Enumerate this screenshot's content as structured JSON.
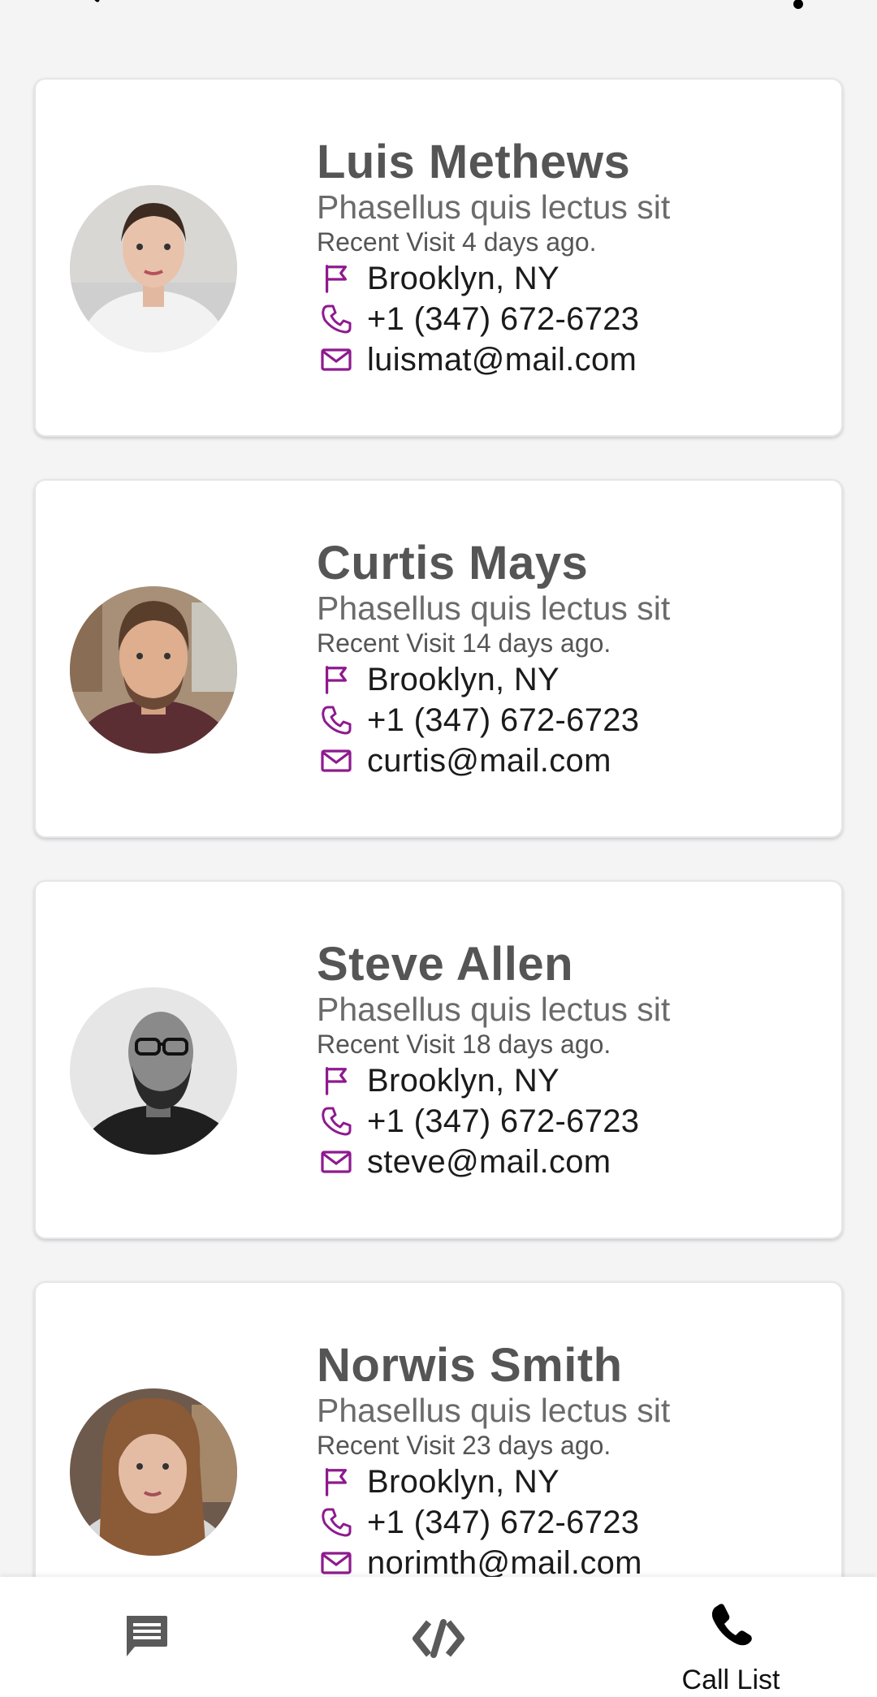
{
  "contacts": [
    {
      "name": "Luis Methews",
      "subtitle": "Phasellus quis lectus sit",
      "recent": "Recent Visit 4 days ago.",
      "location": "Brooklyn, NY",
      "phone": "+1 (347) 672-6723",
      "email": "luismat@mail.com"
    },
    {
      "name": "Curtis Mays",
      "subtitle": "Phasellus quis lectus sit",
      "recent": "Recent Visit 14 days ago.",
      "location": "Brooklyn, NY",
      "phone": "+1 (347) 672-6723",
      "email": "curtis@mail.com"
    },
    {
      "name": "Steve Allen",
      "subtitle": "Phasellus quis lectus sit",
      "recent": "Recent Visit 18 days ago.",
      "location": "Brooklyn, NY",
      "phone": "+1 (347) 672-6723",
      "email": "steve@mail.com"
    },
    {
      "name": "Norwis Smith",
      "subtitle": "Phasellus quis lectus sit",
      "recent": "Recent Visit 23 days ago.",
      "location": "Brooklyn, NY",
      "phone": "+1 (347) 672-6723",
      "email": "norimth@mail.com"
    }
  ],
  "icons": {
    "location": "flag-icon",
    "phone": "phone-icon",
    "email": "mail-icon",
    "search": "search-icon",
    "more": "more-vert-icon"
  },
  "colors": {
    "accent": "#8e1a8e",
    "name_text": "#555555",
    "background": "#f4f4f5"
  },
  "bottom_nav": {
    "items": [
      {
        "icon": "message-icon",
        "label": ""
      },
      {
        "icon": "code-icon",
        "label": ""
      },
      {
        "icon": "phone-icon",
        "label": "Call List"
      }
    ]
  }
}
